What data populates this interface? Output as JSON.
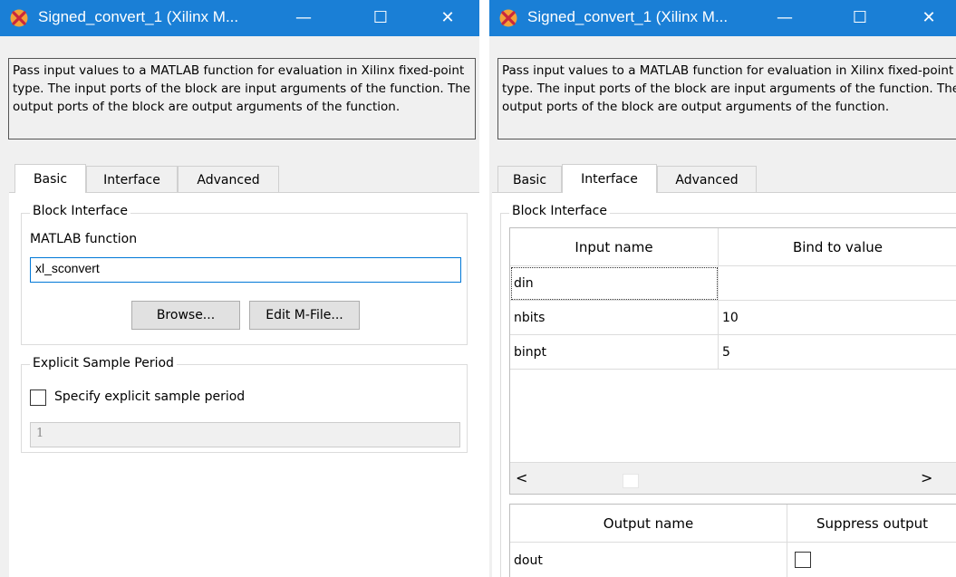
{
  "left_window": {
    "title": "Signed_convert_1 (Xilinx M...",
    "controls": {
      "minimize": "—",
      "maximize": "☐",
      "close": "✕"
    },
    "description": "Pass input values to a MATLAB function for evaluation in Xilinx fixed-point type. The input ports of the block are input arguments of the function. The output ports of the block are output arguments of the function.",
    "tabs": [
      {
        "label": "Basic"
      },
      {
        "label": "Interface"
      },
      {
        "label": "Advanced"
      }
    ],
    "active_tab": "Basic",
    "block_interface": {
      "title": "Block Interface",
      "matlab_function_label": "MATLAB function",
      "matlab_function_value": "xl_sconvert",
      "browse_label": "Browse...",
      "edit_label": "Edit M-File..."
    },
    "sample_period": {
      "title": "Explicit Sample Period",
      "checkbox_label": "Specify explicit sample period",
      "checked": false,
      "value": "1"
    }
  },
  "right_window": {
    "title": "Signed_convert_1 (Xilinx M...",
    "controls": {
      "minimize": "—",
      "maximize": "☐",
      "close": "✕"
    },
    "description": "Pass input values to a MATLAB function for evaluation in Xilinx fixed-point type. The input ports of the block are input arguments of the function. The output ports of the block are output arguments of the function.",
    "tabs": [
      {
        "label": "Basic"
      },
      {
        "label": "Interface"
      },
      {
        "label": "Advanced"
      }
    ],
    "active_tab": "Interface",
    "block_interface_title": "Block Interface",
    "input_table": {
      "headers": [
        "Input name",
        "Bind to value"
      ],
      "rows": [
        {
          "name": "din",
          "value": ""
        },
        {
          "name": "nbits",
          "value": "10"
        },
        {
          "name": "binpt",
          "value": "5"
        }
      ]
    },
    "output_table": {
      "headers": [
        "Output name",
        "Suppress output"
      ],
      "rows": [
        {
          "name": "dout",
          "suppressed": false
        }
      ]
    },
    "scroll": {
      "left": "<",
      "right": ">"
    }
  },
  "colors": {
    "titlebar": "#1a7fd6",
    "focus_border": "#0078d7",
    "dialog_bg": "#f0f0f0"
  },
  "icons": {
    "app": "xilinx-logo-icon",
    "minimize": "minimize-icon",
    "maximize": "maximize-icon",
    "close": "close-icon"
  }
}
